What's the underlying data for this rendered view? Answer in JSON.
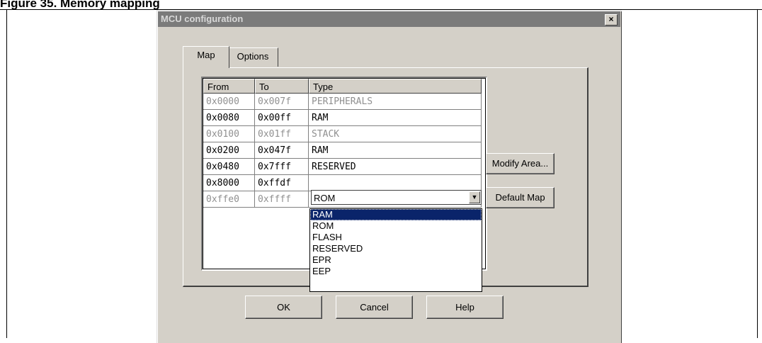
{
  "page": {
    "caption": "Figure 35. Memory mapping"
  },
  "dialog": {
    "title": "MCU configuration",
    "close_label": "×",
    "tabs": [
      {
        "label": "Map"
      },
      {
        "label": "Options"
      }
    ],
    "table": {
      "columns": [
        "From",
        "To",
        "Type"
      ],
      "rows": [
        {
          "from": "0x0000",
          "to": "0x007f",
          "type": "PERIPHERALS",
          "dim": true
        },
        {
          "from": "0x0080",
          "to": "0x00ff",
          "type": "RAM",
          "dim": false
        },
        {
          "from": "0x0100",
          "to": "0x01ff",
          "type": "STACK",
          "dim": true
        },
        {
          "from": "0x0200",
          "to": "0x047f",
          "type": "RAM",
          "dim": false
        },
        {
          "from": "0x0480",
          "to": "0x7fff",
          "type": "RESERVED",
          "dim": false
        },
        {
          "from": "0x8000",
          "to": "0xffdf",
          "type": "",
          "dim": false
        },
        {
          "from": "0xffe0",
          "to": "0xffff",
          "type": "",
          "dim": true
        }
      ]
    },
    "type_combo": {
      "value": "ROM",
      "options": [
        "RAM",
        "ROM",
        "FLASH",
        "RESERVED",
        "EPR",
        "EEP"
      ],
      "highlighted": "RAM"
    },
    "buttons": {
      "modify_area": "Modify Area...",
      "default_map": "Default Map",
      "ok": "OK",
      "cancel": "Cancel",
      "help": "Help"
    }
  }
}
